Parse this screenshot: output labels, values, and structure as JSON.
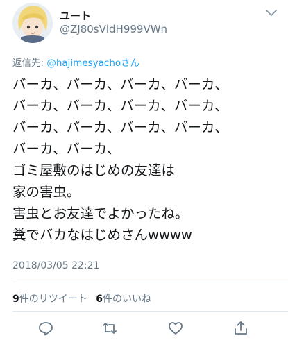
{
  "user": {
    "display_name": "ユート",
    "handle": "@ZJ80sVldH999VWn"
  },
  "reply": {
    "prefix": "返信先: ",
    "target": "@hajimesyachoさん"
  },
  "tweet": {
    "lines": [
      "バーカ、バーカ、バーカ、バーカ、",
      "バーカ、バーカ、バーカ、バーカ、",
      "バーカ、バーカ、バーカ、バーカ、",
      "バーカ、バーカ、",
      "ゴミ屋敷のはじめの友達は",
      "家の害虫。",
      "害虫とお友達でよかったね。",
      "糞でバカなはじめさんwwww"
    ],
    "timestamp": "2018/03/05 22:21"
  },
  "stats": {
    "retweets_count": "9",
    "retweets_label": "件のリツイート",
    "likes_count": "6",
    "likes_label": "件のいいね"
  },
  "icons": {
    "more": "chevron-down-icon",
    "reply": "reply-icon",
    "retweet": "retweet-icon",
    "like": "heart-icon",
    "share": "share-icon"
  },
  "colors": {
    "text": "#14171a",
    "secondary": "#657786",
    "link": "#1da1f2",
    "divider": "#e1e8ed"
  }
}
